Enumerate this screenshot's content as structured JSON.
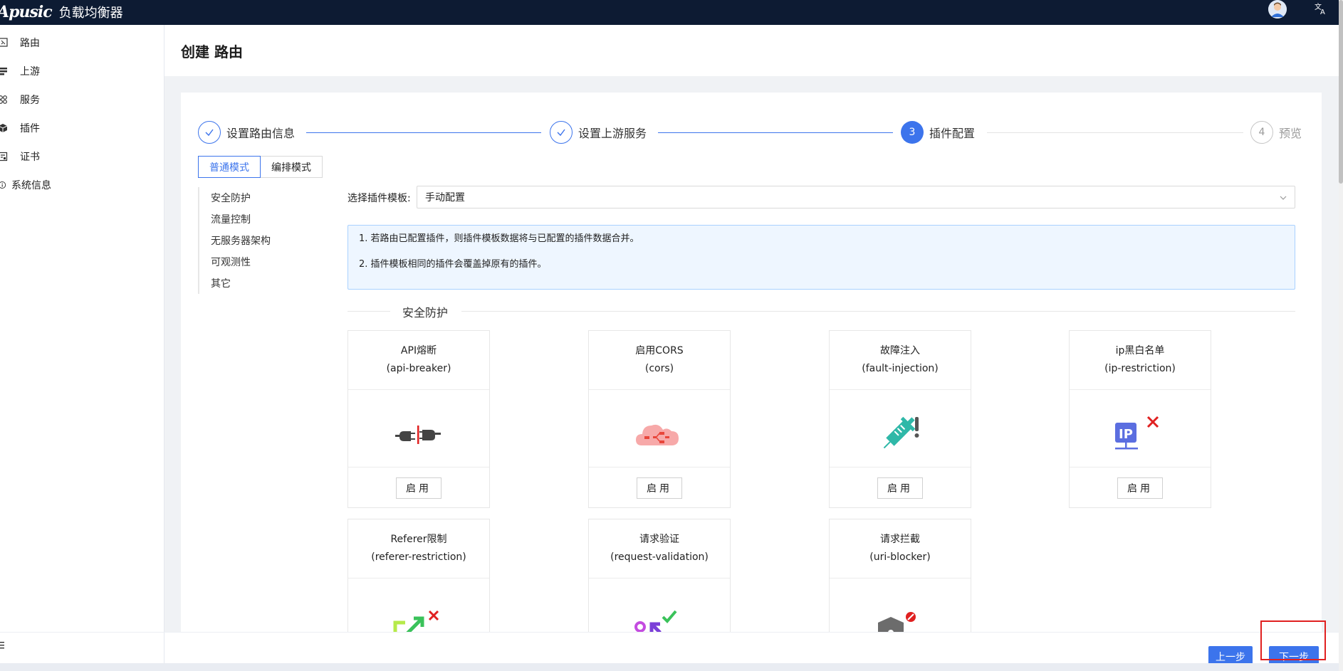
{
  "header": {
    "logo": "Apusic",
    "product": "负载均衡器"
  },
  "sidebar": {
    "items": [
      {
        "label": "路由",
        "icon": "route-icon"
      },
      {
        "label": "上游",
        "icon": "upstream-icon"
      },
      {
        "label": "服务",
        "icon": "service-icon"
      },
      {
        "label": "插件",
        "icon": "plugin-icon"
      },
      {
        "label": "证书",
        "icon": "certificate-icon"
      },
      {
        "label": "系统信息",
        "icon": "info-icon"
      }
    ]
  },
  "page": {
    "title": "创建 路由"
  },
  "steps": [
    {
      "title": "设置路由信息",
      "status": "done"
    },
    {
      "title": "设置上游服务",
      "status": "done"
    },
    {
      "title": "插件配置",
      "status": "active",
      "number": "3"
    },
    {
      "title": "预览",
      "status": "wait",
      "number": "4"
    }
  ],
  "mode_tabs": [
    {
      "label": "普通模式",
      "active": true
    },
    {
      "label": "编排模式",
      "active": false
    }
  ],
  "categories": [
    "安全防护",
    "流量控制",
    "无服务器架构",
    "可观测性",
    "其它"
  ],
  "template": {
    "label": "选择插件模板:",
    "value": "手动配置"
  },
  "notice": [
    "1. 若路由已配置插件，则插件模板数据将与已配置的插件数据合并。",
    "2. 插件模板相同的插件会覆盖掉原有的插件。"
  ],
  "section": {
    "title": "安全防护"
  },
  "plugins": [
    {
      "name": "API熔断",
      "id": "(api-breaker)",
      "icon": "plug-disconnect-icon",
      "button": "启用"
    },
    {
      "name": "启用CORS",
      "id": "(cors)",
      "icon": "cloud-cors-icon",
      "button": "启用"
    },
    {
      "name": "故障注入",
      "id": "(fault-injection)",
      "icon": "syringe-alert-icon",
      "button": "启用"
    },
    {
      "name": "ip黑白名单",
      "id": "(ip-restriction)",
      "icon": "ip-block-icon",
      "button": "启用"
    },
    {
      "name": "Referer限制",
      "id": "(referer-restriction)",
      "icon": "redirect-block-icon"
    },
    {
      "name": "请求验证",
      "id": "(request-validation)",
      "icon": "request-check-icon"
    },
    {
      "name": "请求拦截",
      "id": "(uri-blocker)",
      "icon": "uri-block-icon"
    }
  ],
  "actions": {
    "prev": "上一步",
    "next": "下一步"
  },
  "colors": {
    "primary": "#3c74ec",
    "header_bg": "#0d1b33",
    "highlight": "#e02020"
  }
}
